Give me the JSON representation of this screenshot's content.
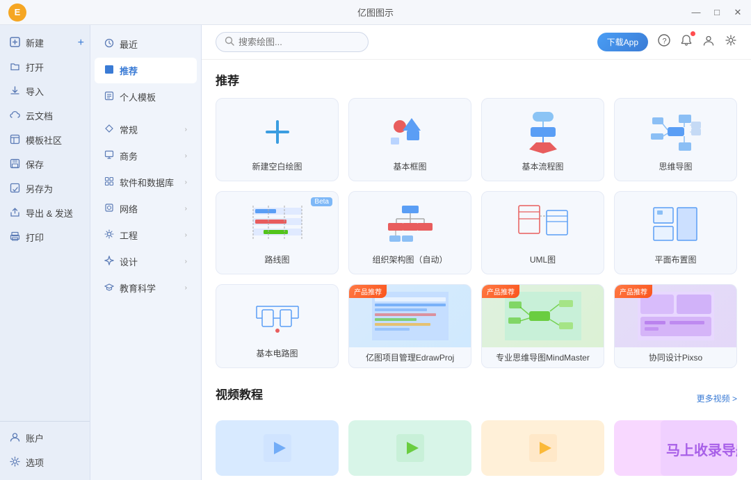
{
  "app": {
    "title": "亿图图示"
  },
  "titlebar": {
    "avatar_letter": "E",
    "minimize": "—",
    "maximize": "□",
    "close": "✕"
  },
  "left_sidebar": {
    "new_label": "新建",
    "open_label": "打开",
    "import_label": "导入",
    "cloud_label": "云文档",
    "template_label": "模板社区",
    "save_label": "保存",
    "save_as_label": "另存为",
    "export_label": "导出 & 发送",
    "print_label": "打印",
    "account_label": "账户",
    "settings_label": "选项"
  },
  "mid_nav": {
    "items": [
      {
        "id": "recent",
        "label": "最近",
        "icon": "clock"
      },
      {
        "id": "recommend",
        "label": "推荐",
        "icon": "star",
        "active": true
      },
      {
        "id": "personal",
        "label": "个人模板",
        "icon": "file"
      },
      {
        "id": "general",
        "label": "常规",
        "icon": "diamond",
        "arrow": true
      },
      {
        "id": "business",
        "label": "商务",
        "icon": "monitor",
        "arrow": true
      },
      {
        "id": "software",
        "label": "软件和数据库",
        "icon": "grid",
        "arrow": true
      },
      {
        "id": "network",
        "label": "网络",
        "icon": "box",
        "arrow": true
      },
      {
        "id": "engineering",
        "label": "工程",
        "icon": "settings",
        "arrow": true
      },
      {
        "id": "design",
        "label": "设计",
        "icon": "sparkle",
        "arrow": true
      },
      {
        "id": "education",
        "label": "教育科学",
        "icon": "graduation",
        "arrow": true
      }
    ]
  },
  "content_topbar": {
    "search_placeholder": "搜索绘图...",
    "download_btn": "下载App",
    "icons": [
      "question",
      "bell",
      "user",
      "settings"
    ]
  },
  "recommend_section": {
    "title": "推荐",
    "templates": [
      {
        "id": "new_blank",
        "label": "新建空白绘图",
        "type": "blank",
        "icon": "plus"
      },
      {
        "id": "basic_frame",
        "label": "基本框图",
        "type": "diagram"
      },
      {
        "id": "basic_flow",
        "label": "基本流程图",
        "type": "flow"
      },
      {
        "id": "mindmap",
        "label": "思维导图",
        "type": "mind"
      },
      {
        "id": "roadmap",
        "label": "路线图",
        "type": "roadmap",
        "beta": true
      },
      {
        "id": "org_auto",
        "label": "组织架构图（自动）",
        "type": "org"
      },
      {
        "id": "uml",
        "label": "UML图",
        "type": "uml"
      },
      {
        "id": "floorplan",
        "label": "平面布置图",
        "type": "floor"
      },
      {
        "id": "circuit",
        "label": "基本电路图",
        "type": "circuit"
      },
      {
        "id": "edrawproj",
        "label": "亿图项目管理EdrawProj",
        "type": "product",
        "product_tag": "产品推荐",
        "bg": "blue"
      },
      {
        "id": "mindmaster",
        "label": "专业思维导图MindMaster",
        "type": "product",
        "product_tag": "产品推荐",
        "bg": "green"
      },
      {
        "id": "pixso",
        "label": "协同设计Pixso",
        "type": "product",
        "product_tag": "产品推荐",
        "bg": "purple"
      }
    ]
  },
  "video_section": {
    "title": "视频教程",
    "more_label": "更多视频 >",
    "videos": [
      {
        "id": "v1",
        "color": "#d0e8ff"
      },
      {
        "id": "v2",
        "color": "#ffe7d0"
      },
      {
        "id": "v3",
        "color": "#d0f0e0"
      },
      {
        "id": "v4",
        "color": "#f0d0ff"
      }
    ]
  },
  "bottom_overlay": {
    "text": "马上收录导航"
  }
}
